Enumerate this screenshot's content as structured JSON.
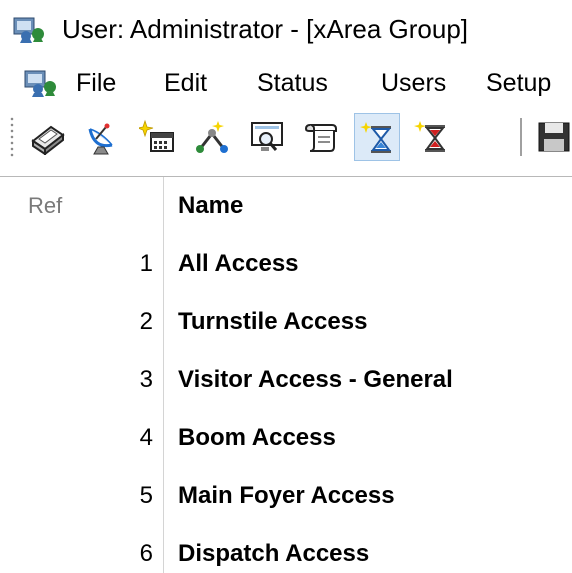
{
  "window": {
    "title": "User: Administrator - [xArea Group]"
  },
  "menu": {
    "items": [
      "File",
      "Edit",
      "Status",
      "Users",
      "Setup"
    ]
  },
  "toolbar": {
    "buttons": [
      {
        "icon": "scanner-icon"
      },
      {
        "icon": "satellite-dish-icon"
      },
      {
        "icon": "calendar-new-icon"
      },
      {
        "icon": "network-tool-icon"
      },
      {
        "icon": "screen-search-icon"
      },
      {
        "icon": "scroll-icon"
      },
      {
        "icon": "hourglass-new-icon",
        "active": true
      },
      {
        "icon": "hourglass-red-icon"
      },
      {
        "icon": "save-icon"
      }
    ]
  },
  "grid": {
    "columns": [
      "Ref",
      "Name"
    ],
    "rows": [
      {
        "ref": "1",
        "name": "All Access"
      },
      {
        "ref": "2",
        "name": "Turnstile Access"
      },
      {
        "ref": "3",
        "name": "Visitor Access - General"
      },
      {
        "ref": "4",
        "name": "Boom Access"
      },
      {
        "ref": "5",
        "name": "Main Foyer Access"
      },
      {
        "ref": "6",
        "name": "Dispatch Access"
      }
    ]
  },
  "colors": {
    "active_button_bg": "#dceaf8",
    "active_button_border": "#9ec3e6",
    "header_ref_text": "#7a7a7a"
  }
}
